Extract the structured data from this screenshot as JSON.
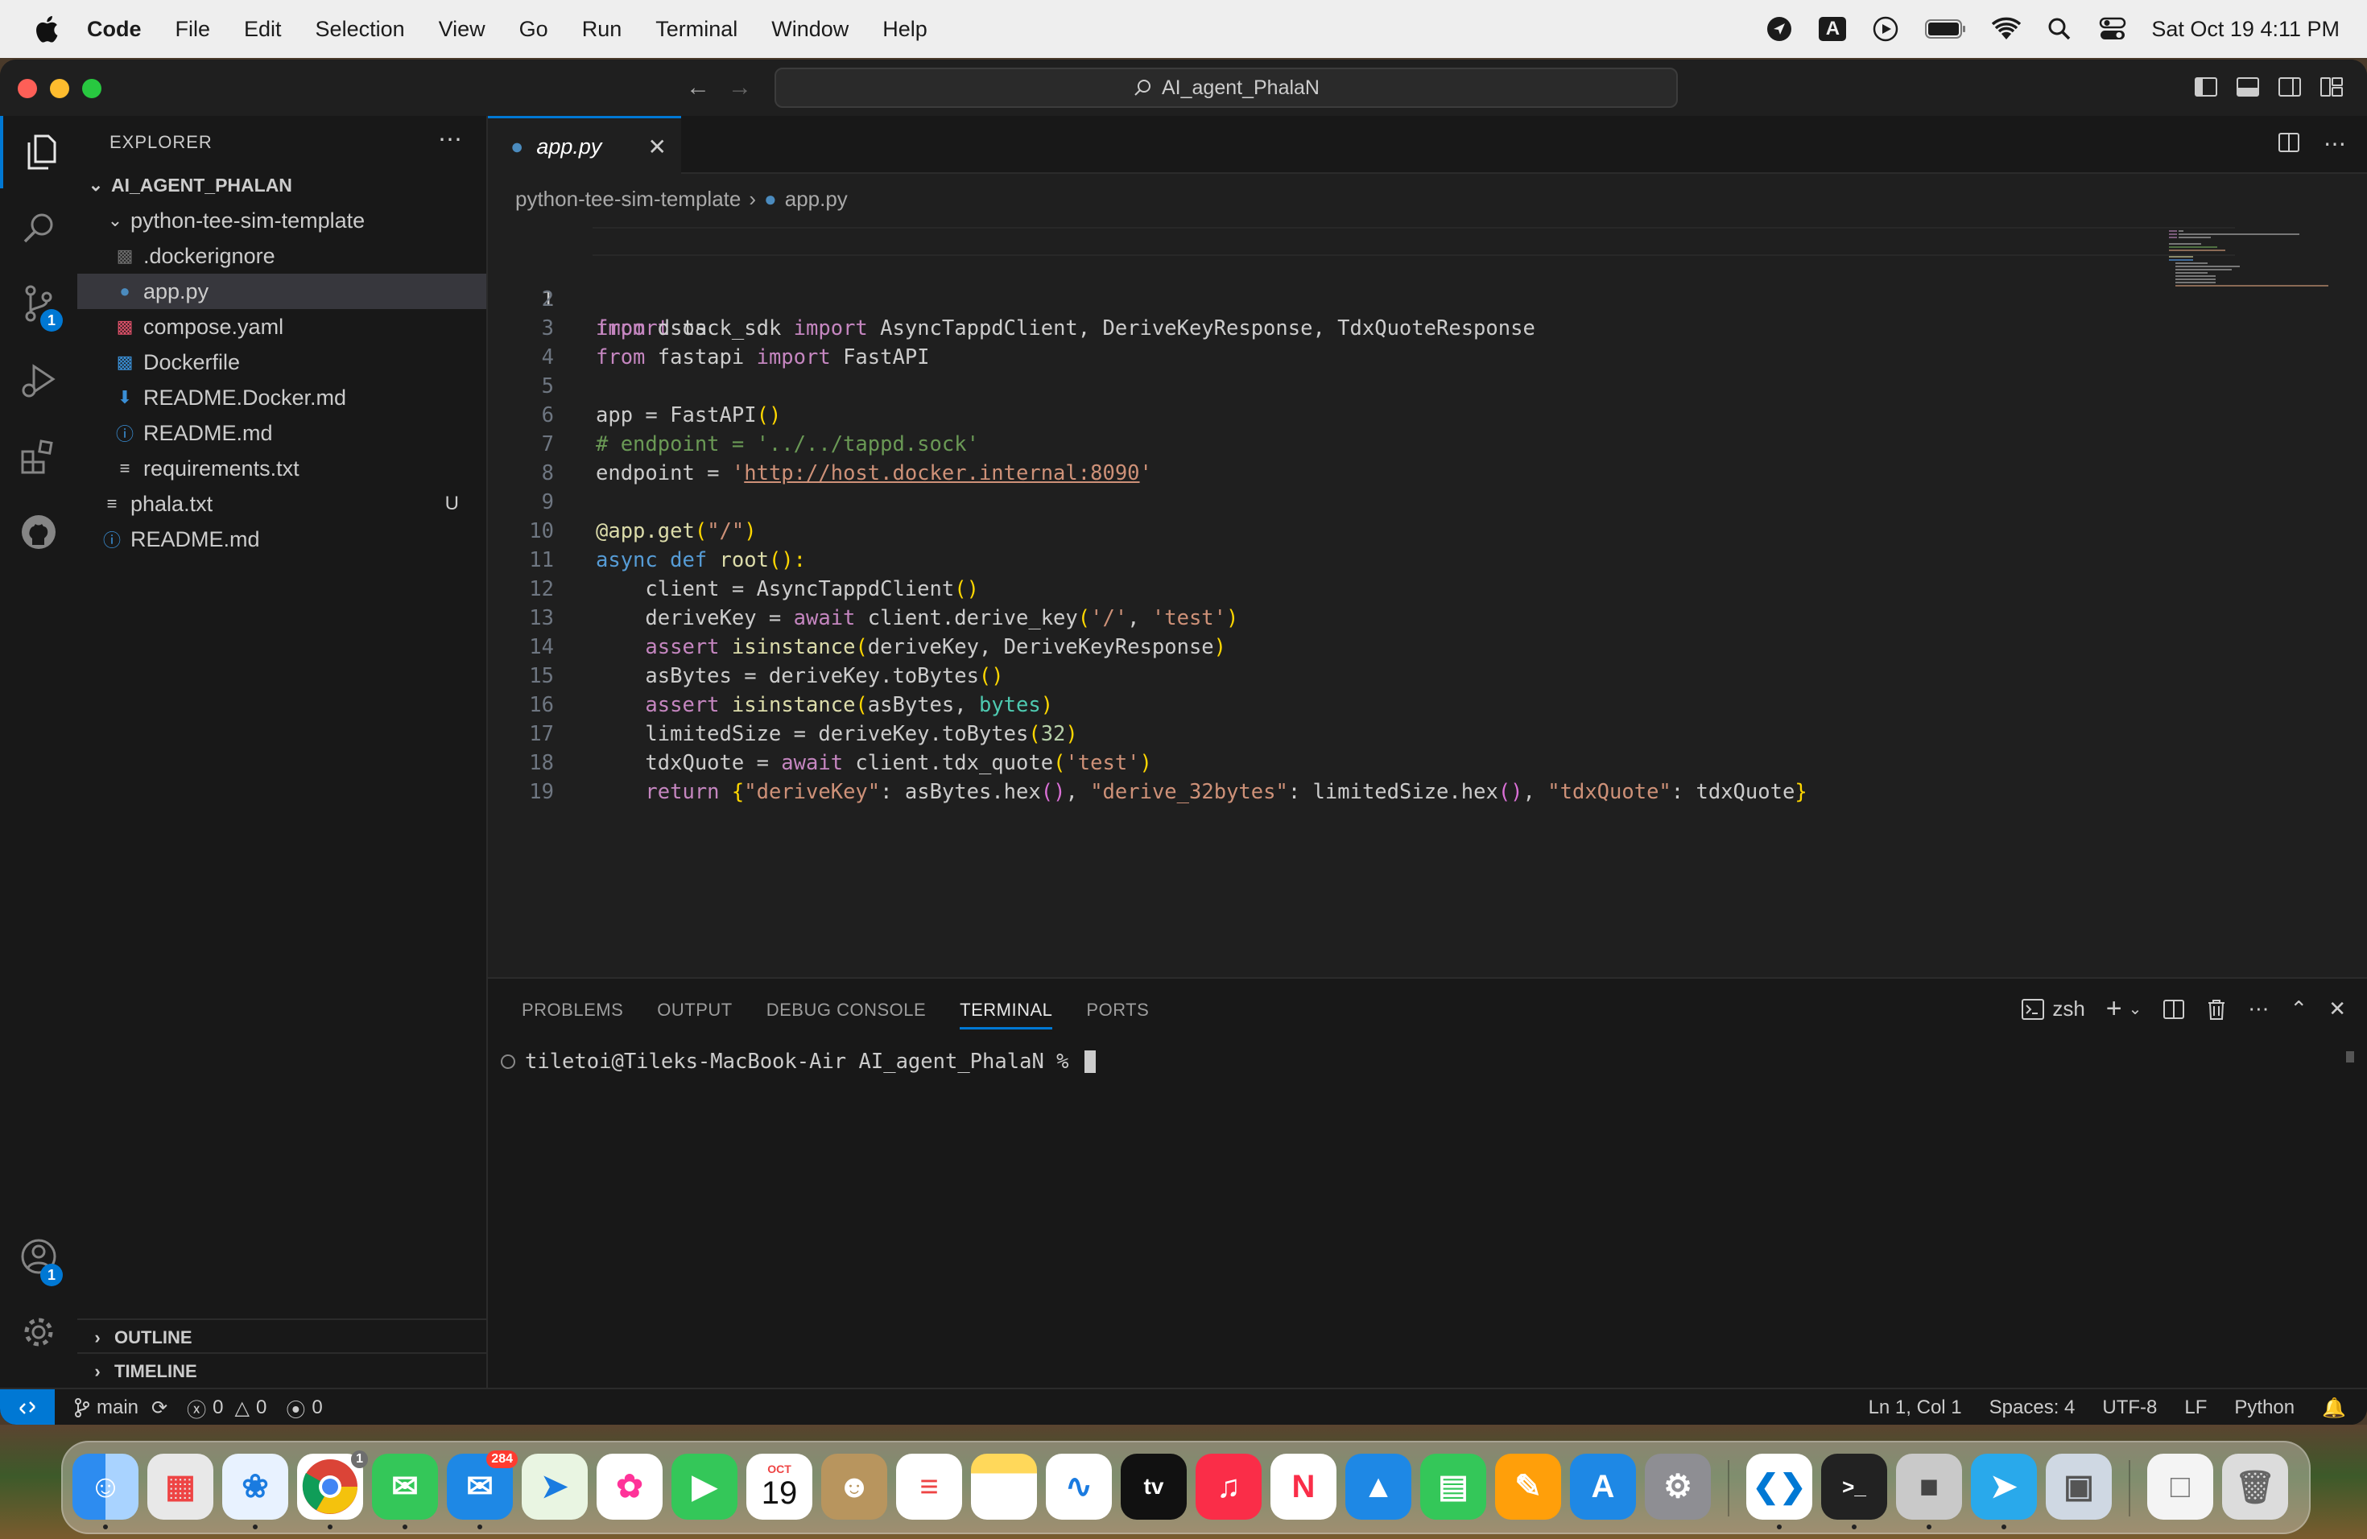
{
  "menubar": {
    "app_name": "Code",
    "items": [
      "File",
      "Edit",
      "Selection",
      "View",
      "Go",
      "Run",
      "Terminal",
      "Window",
      "Help"
    ],
    "datetime": "Sat Oct 19  4:11 PM",
    "input_source": "A"
  },
  "titlebar": {
    "search_text": "AI_agent_PhalaN"
  },
  "activitybar": {
    "source_control_badge": "1",
    "accounts_badge": "1"
  },
  "explorer": {
    "title": "EXPLORER",
    "root": "AI_AGENT_PHALAN",
    "folder": "python-tee-sim-template",
    "files": [
      {
        "name": ".dockerignore",
        "icon": "docker-ignore-icon"
      },
      {
        "name": "app.py",
        "icon": "python-icon"
      },
      {
        "name": "compose.yaml",
        "icon": "compose-icon"
      },
      {
        "name": "Dockerfile",
        "icon": "docker-icon"
      },
      {
        "name": "README.Docker.md",
        "icon": "download-icon"
      },
      {
        "name": "README.md",
        "icon": "info-icon"
      },
      {
        "name": "requirements.txt",
        "icon": "lines-icon"
      }
    ],
    "root_files": [
      {
        "name": "phala.txt",
        "status": "U"
      },
      {
        "name": "README.md"
      }
    ],
    "outline": "OUTLINE",
    "timeline": "TIMELINE"
  },
  "editor": {
    "tab_label": "app.py",
    "breadcrumb": [
      "python-tee-sim-template",
      "app.py"
    ],
    "line_numbers": [
      "1",
      "2",
      "3",
      "4",
      "5",
      "6",
      "7",
      "8",
      "9",
      "10",
      "11",
      "12",
      "13",
      "14",
      "15",
      "16",
      "17",
      "18",
      "19"
    ],
    "tokens": {
      "import": "import",
      "os": " os",
      "from": "from",
      "dstack_sdk": " dstack_sdk ",
      "import2": "import",
      "l2rest": " AsyncTappdClient, DeriveKeyResponse, TdxQuoteResponse",
      "from3": "from",
      "fastapi": " fastapi ",
      "import3": "import",
      "l3rest": " FastAPI",
      "l5a": "app = FastAPI",
      "l5b": "()",
      "l6": "# endpoint = '../../tappd.sock'",
      "l7a": "endpoint = ",
      "l7q1": "'",
      "l7url": "http://host.docker.internal:8090",
      "l7q2": "'",
      "l9a": "@app.get",
      "l9b": "(",
      "l9c": "\"/\"",
      "l9d": ")",
      "l10a": "async",
      "l10b": " def ",
      "l10c": "root",
      "l10d": "():",
      "l11a": "    client = AsyncTappdClient",
      "l11b": "()",
      "l12a": "    deriveKey = ",
      "l12b": "await",
      "l12c": " client.derive_key",
      "l12d": "(",
      "l12e": "'/'",
      "l12f": ", ",
      "l12g": "'test'",
      "l12h": ")",
      "l13a": "    ",
      "l13b": "assert",
      "l13c": " ",
      "l13d": "isinstance",
      "l13e": "(",
      "l13f": "deriveKey, DeriveKeyResponse",
      "l13g": ")",
      "l14a": "    asBytes = deriveKey.toBytes",
      "l14b": "()",
      "l15a": "    ",
      "l15b": "assert",
      "l15c": " ",
      "l15d": "isinstance",
      "l15e": "(",
      "l15f": "asBytes, ",
      "l15g": "bytes",
      "l15h": ")",
      "l16a": "    limitedSize = deriveKey.toBytes",
      "l16b": "(",
      "l16c": "32",
      "l16d": ")",
      "l17a": "    tdxQuote = ",
      "l17b": "await",
      "l17c": " client.tdx_quote",
      "l17d": "(",
      "l17e": "'test'",
      "l17f": ")",
      "l18a": "    ",
      "l18b": "return",
      "l18c": " ",
      "l18d": "{",
      "l18e": "\"deriveKey\"",
      "l18f": ": asBytes.hex",
      "l18g": "()",
      "l18h": ", ",
      "l18i": "\"derive_32bytes\"",
      "l18j": ": limitedSize.hex",
      "l18k": "()",
      "l18l": ", ",
      "l18m": "\"tdxQuote\"",
      "l18n": ": tdxQuote",
      "l18o": "}"
    }
  },
  "panel": {
    "tabs": [
      "PROBLEMS",
      "OUTPUT",
      "DEBUG CONSOLE",
      "TERMINAL",
      "PORTS"
    ],
    "active_tab": "TERMINAL",
    "shell": "zsh",
    "prompt": "tiletoi@Tileks-MacBook-Air AI_agent_PhalaN % "
  },
  "statusbar": {
    "branch": "main",
    "errors": "0",
    "warnings": "0",
    "ports": "0",
    "position": "Ln 1, Col 1",
    "spaces": "Spaces: 4",
    "encoding": "UTF-8",
    "eol": "LF",
    "language": "Python"
  },
  "dock": {
    "calendar_month": "OCT",
    "calendar_day": "19",
    "mail_badge": "284",
    "chrome_badge": "1"
  },
  "colors": {
    "accent": "#0078d4",
    "editor_bg": "#1f1f1f",
    "sidebar_bg": "#181818"
  }
}
